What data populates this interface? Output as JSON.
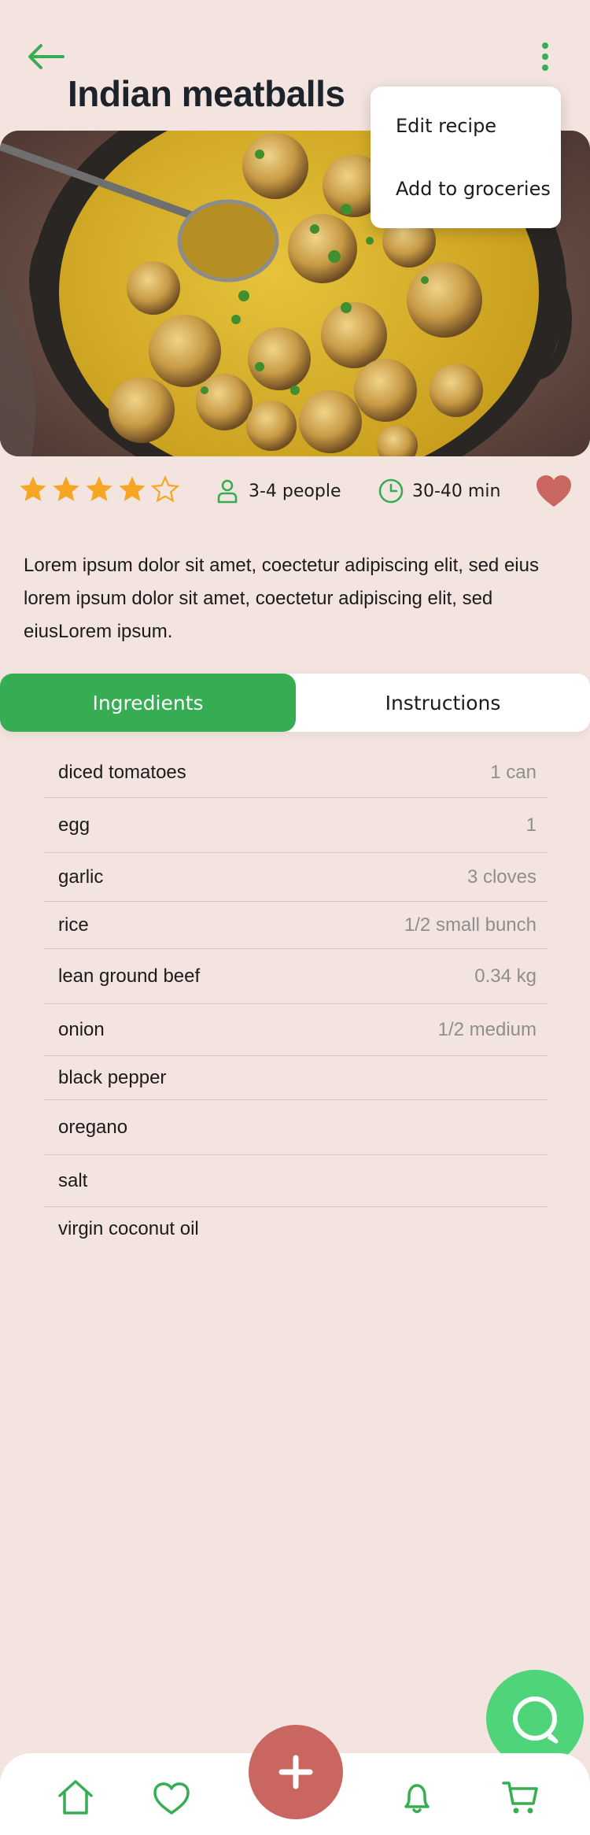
{
  "header": {
    "title": "Indian meatballs",
    "back_icon": "arrow-left-icon",
    "menu_icon": "kebab-menu-icon"
  },
  "menu": {
    "items": [
      {
        "label": "Edit recipe"
      },
      {
        "label": "Add to groceries"
      }
    ]
  },
  "recipe": {
    "rating": 4,
    "rating_max": 5,
    "servings": "3-4 people",
    "time": "30-40 min",
    "favorite": true,
    "description": "Lorem ipsum dolor sit amet, coectetur adipiscing elit, sed eius lorem ipsum dolor sit amet, coectetur adipiscing elit, sed eiusLorem ipsum."
  },
  "tabs": {
    "ingredients": "Ingredients",
    "instructions": "Instructions",
    "active": "ingredients"
  },
  "ingredients": [
    {
      "name": "diced tomatoes",
      "qty": "1 can"
    },
    {
      "name": "egg",
      "qty": "1"
    },
    {
      "name": "garlic",
      "qty": "3 cloves"
    },
    {
      "name": "rice",
      "qty": "1/2 small bunch"
    },
    {
      "name": "lean ground beef",
      "qty": "0.34 kg"
    },
    {
      "name": "onion",
      "qty": "1/2 medium"
    },
    {
      "name": "black pepper",
      "qty": ""
    },
    {
      "name": "oregano",
      "qty": ""
    },
    {
      "name": "salt",
      "qty": ""
    },
    {
      "name": "virgin coconut oil",
      "qty": ""
    }
  ],
  "bottom_nav": {
    "items": [
      "home-icon",
      "heart-icon",
      "plus-icon",
      "bell-icon",
      "cart-icon"
    ]
  },
  "colors": {
    "background": "#f4e4df",
    "accent_green": "#37ad53",
    "star": "#f5a623",
    "favorite_red": "#c9665f",
    "chat_green": "#4fd47a"
  }
}
